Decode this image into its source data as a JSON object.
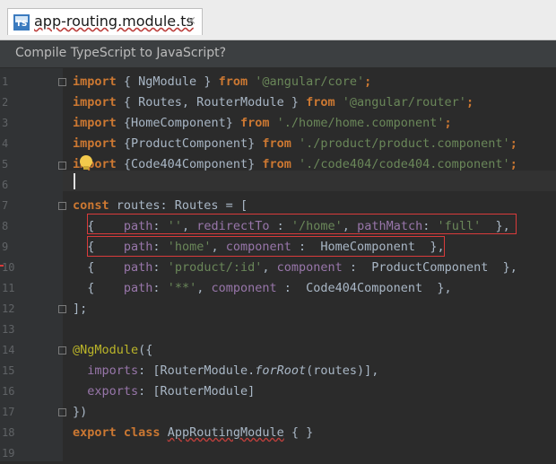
{
  "tab": {
    "title": "app-routing.module.ts",
    "icon": "TS",
    "close": "×"
  },
  "notice": {
    "text": "Compile TypeScript to JavaScript?"
  },
  "lines": [
    {
      "n": "1"
    },
    {
      "n": "2"
    },
    {
      "n": "3"
    },
    {
      "n": "4"
    },
    {
      "n": "5"
    },
    {
      "n": "6"
    },
    {
      "n": "7"
    },
    {
      "n": "8"
    },
    {
      "n": "9"
    },
    {
      "n": "10"
    },
    {
      "n": "11"
    },
    {
      "n": "12"
    },
    {
      "n": "13"
    },
    {
      "n": "14"
    },
    {
      "n": "15"
    },
    {
      "n": "16"
    },
    {
      "n": "17"
    },
    {
      "n": "18"
    },
    {
      "n": "19"
    }
  ],
  "code": {
    "l1": {
      "kw": "import",
      "a": " { NgModule } ",
      "kw2": "from",
      "s": " '@angular/core'",
      "e": ";"
    },
    "l2": {
      "kw": "import",
      "a": " { Routes, RouterModule } ",
      "kw2": "from",
      "s": " '@angular/router'",
      "e": ";"
    },
    "l3": {
      "kw": "import",
      "a": " {HomeComponent} ",
      "kw2": "from",
      "s": " './home/home.component'",
      "e": ";"
    },
    "l4": {
      "kw": "import",
      "a": " {ProductComponent} ",
      "kw2": "from",
      "s": " './product/product.component'",
      "e": ";"
    },
    "l5": {
      "kw": "import",
      "a": " {Code404Component} ",
      "kw2": "from",
      "s": " './code404/code404.component'",
      "e": ";"
    },
    "l7": {
      "kw": "const",
      "a": " routes: Routes = ["
    },
    "l8": {
      "a": "  {    ",
      "p1": "path",
      "b": ": ",
      "s1": "''",
      "c": ", ",
      "p2": "redirectTo",
      "d": " : ",
      "s2": "'/home'",
      "f": ", ",
      "p3": "pathMatch",
      "g": ": ",
      "s3": "'full'",
      "h": "  },"
    },
    "l9": {
      "a": "  {    ",
      "p1": "path",
      "b": ": ",
      "s1": "'home'",
      "c": ", ",
      "p2": "component",
      "d": " :  HomeComponent  },"
    },
    "l10": {
      "a": "  {    ",
      "p1": "path",
      "b": ": ",
      "s1": "'product/:id'",
      "c": ", ",
      "p2": "component",
      "d": " :  ProductComponent  },"
    },
    "l11": {
      "a": "  {    ",
      "p1": "path",
      "b": ": ",
      "s1": "'**'",
      "c": ", ",
      "p2": "component",
      "d": " :  Code404Component  },"
    },
    "l12": {
      "a": "];"
    },
    "l14": {
      "ann": "@NgModule",
      "a": "({"
    },
    "l15": {
      "a": "  ",
      "p": "imports",
      "b": ": [RouterModule.",
      "fn": "forRoot",
      "c": "(routes)],"
    },
    "l16": {
      "a": "  ",
      "p": "exports",
      "b": ": [RouterModule]"
    },
    "l17": {
      "a": "})"
    },
    "l18": {
      "kw": "export",
      "a": " ",
      "kw2": "class",
      "b": " ",
      "cls": "AppRoutingModule",
      "c": " { }"
    }
  }
}
